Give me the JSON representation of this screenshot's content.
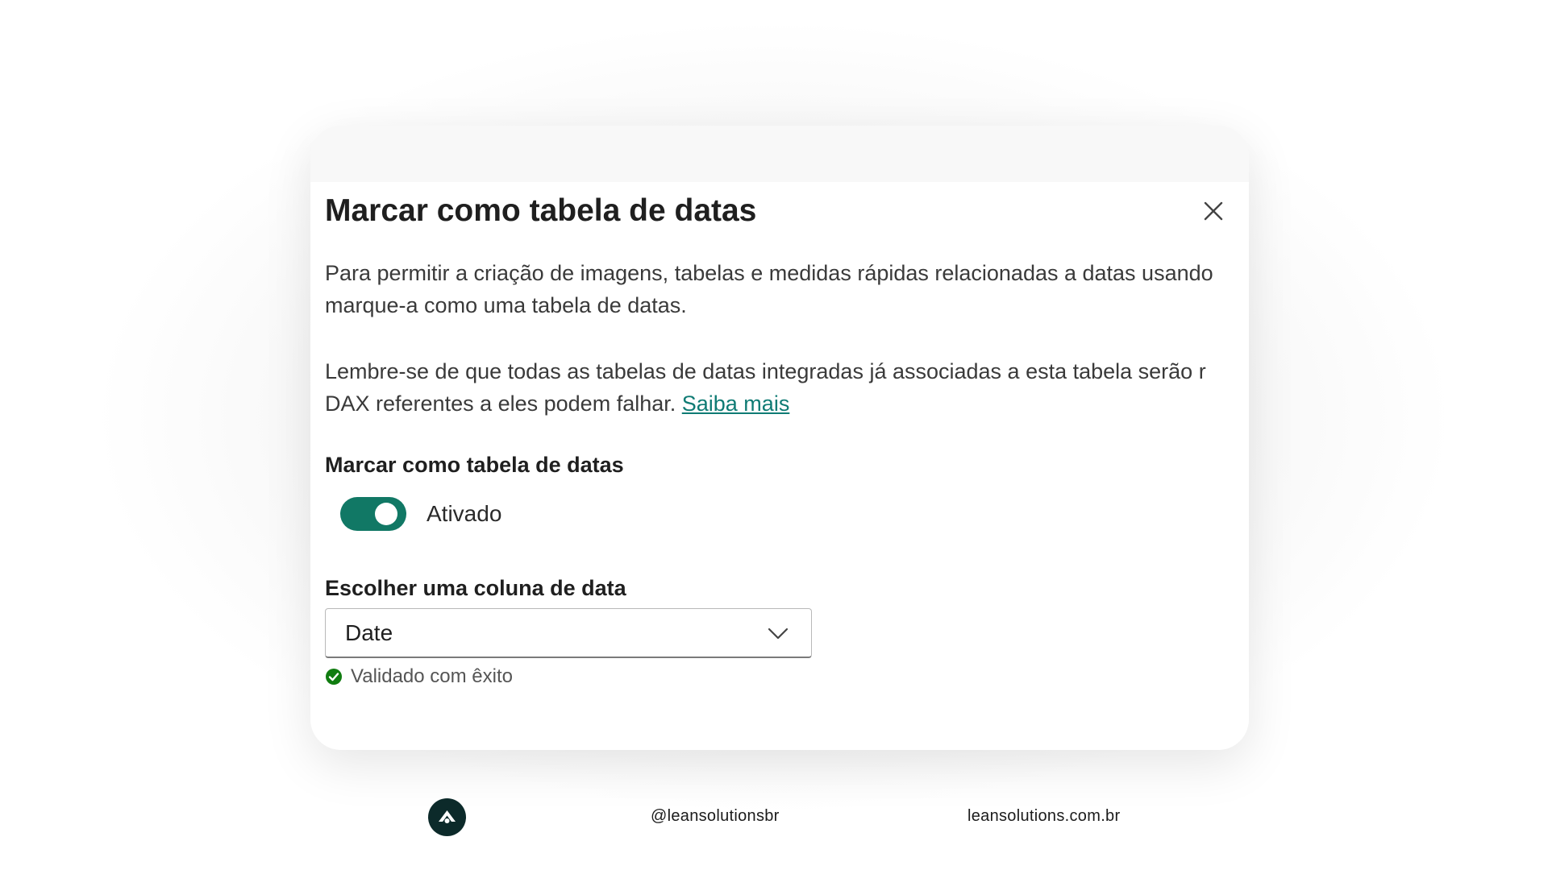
{
  "dialog": {
    "title": "Marcar como tabela de datas",
    "close_icon": "close-icon",
    "paragraph1_line1": "Para permitir a criação de imagens, tabelas e medidas rápidas relacionadas a datas usando",
    "paragraph1_line2": "marque-a como uma tabela de datas.",
    "paragraph2_line1": "Lembre-se de que todas as tabelas de datas integradas já associadas a esta tabela serão r",
    "paragraph2_line2_text": "DAX referentes a eles podem falhar. ",
    "learn_more_link": "Saiba mais",
    "toggle_section_label": "Marcar como tabela de datas",
    "toggle_state": "Ativado",
    "toggle_on": true,
    "column_section_label": "Escolher uma coluna de data",
    "column_select_value": "Date",
    "validation_text": "Validado com êxito",
    "colors": {
      "accent": "#117865",
      "link": "#0f7b74",
      "success": "#107c10"
    }
  },
  "footer": {
    "logo_icon": "brand-logo-icon",
    "handle": "@leansolutionsbr",
    "website": "leansolutions.com.br"
  }
}
